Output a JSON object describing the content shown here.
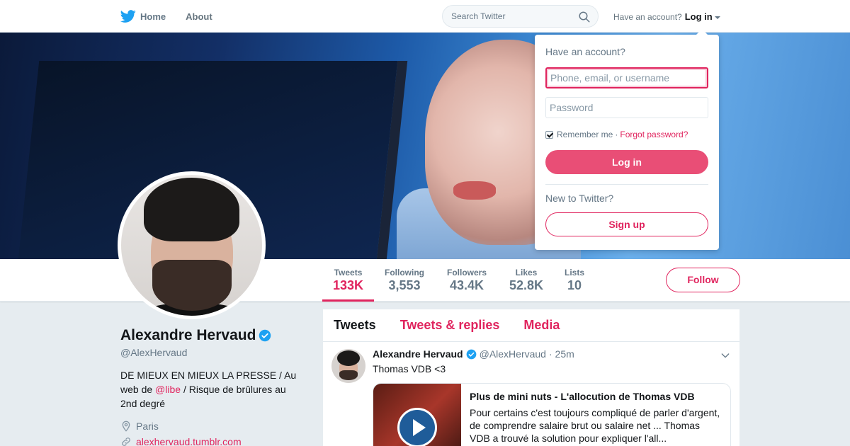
{
  "colors": {
    "accent": "#e0245e",
    "brand_blue": "#1da1f2",
    "muted": "#657786"
  },
  "nav": {
    "home_label": "Home",
    "about_label": "About",
    "search_placeholder": "Search Twitter",
    "have_account": "Have an account?",
    "login_label": "Log in"
  },
  "profile": {
    "name": "Alexandre Hervaud",
    "handle": "@AlexHervaud",
    "bio_before": "DE MIEUX EN MIEUX LA PRESSE / Au web de ",
    "bio_mention": "@libe",
    "bio_after": " / Risque de brûlures au 2nd degré",
    "location": "Paris",
    "website": "alexhervaud.tumblr.com"
  },
  "stats": [
    {
      "label": "Tweets",
      "value": "133K"
    },
    {
      "label": "Following",
      "value": "3,553"
    },
    {
      "label": "Followers",
      "value": "43.4K"
    },
    {
      "label": "Likes",
      "value": "52.8K"
    },
    {
      "label": "Lists",
      "value": "10"
    }
  ],
  "follow_label": "Follow",
  "timeline": {
    "tabs": [
      "Tweets",
      "Tweets & replies",
      "Media"
    ],
    "tweet": {
      "name": "Alexandre Hervaud",
      "handle": "@AlexHervaud",
      "time": "· 25m",
      "text": "Thomas VDB <3",
      "card_title": "Plus de mini nuts - L'allocution de Thomas VDB",
      "card_desc": "Pour certains c'est toujours compliqué de parler d'argent, de comprendre salaire brut ou salaire net ... Thomas VDB a trouvé la solution pour expliquer l'all..."
    }
  },
  "login_dropdown": {
    "title": "Have an account?",
    "username_placeholder": "Phone, email, or username",
    "password_placeholder": "Password",
    "remember": "Remember me",
    "dot": "·",
    "forgot": "Forgot password?",
    "login_button": "Log in",
    "new_to": "New to Twitter?",
    "signup_button": "Sign up"
  },
  "icons": {
    "logo": "twitter-bird-icon",
    "search": "search-icon",
    "verified": "verified-badge-icon",
    "location": "location-pin-icon",
    "link": "link-icon",
    "chevron": "chevron-down-icon",
    "play": "play-icon"
  }
}
